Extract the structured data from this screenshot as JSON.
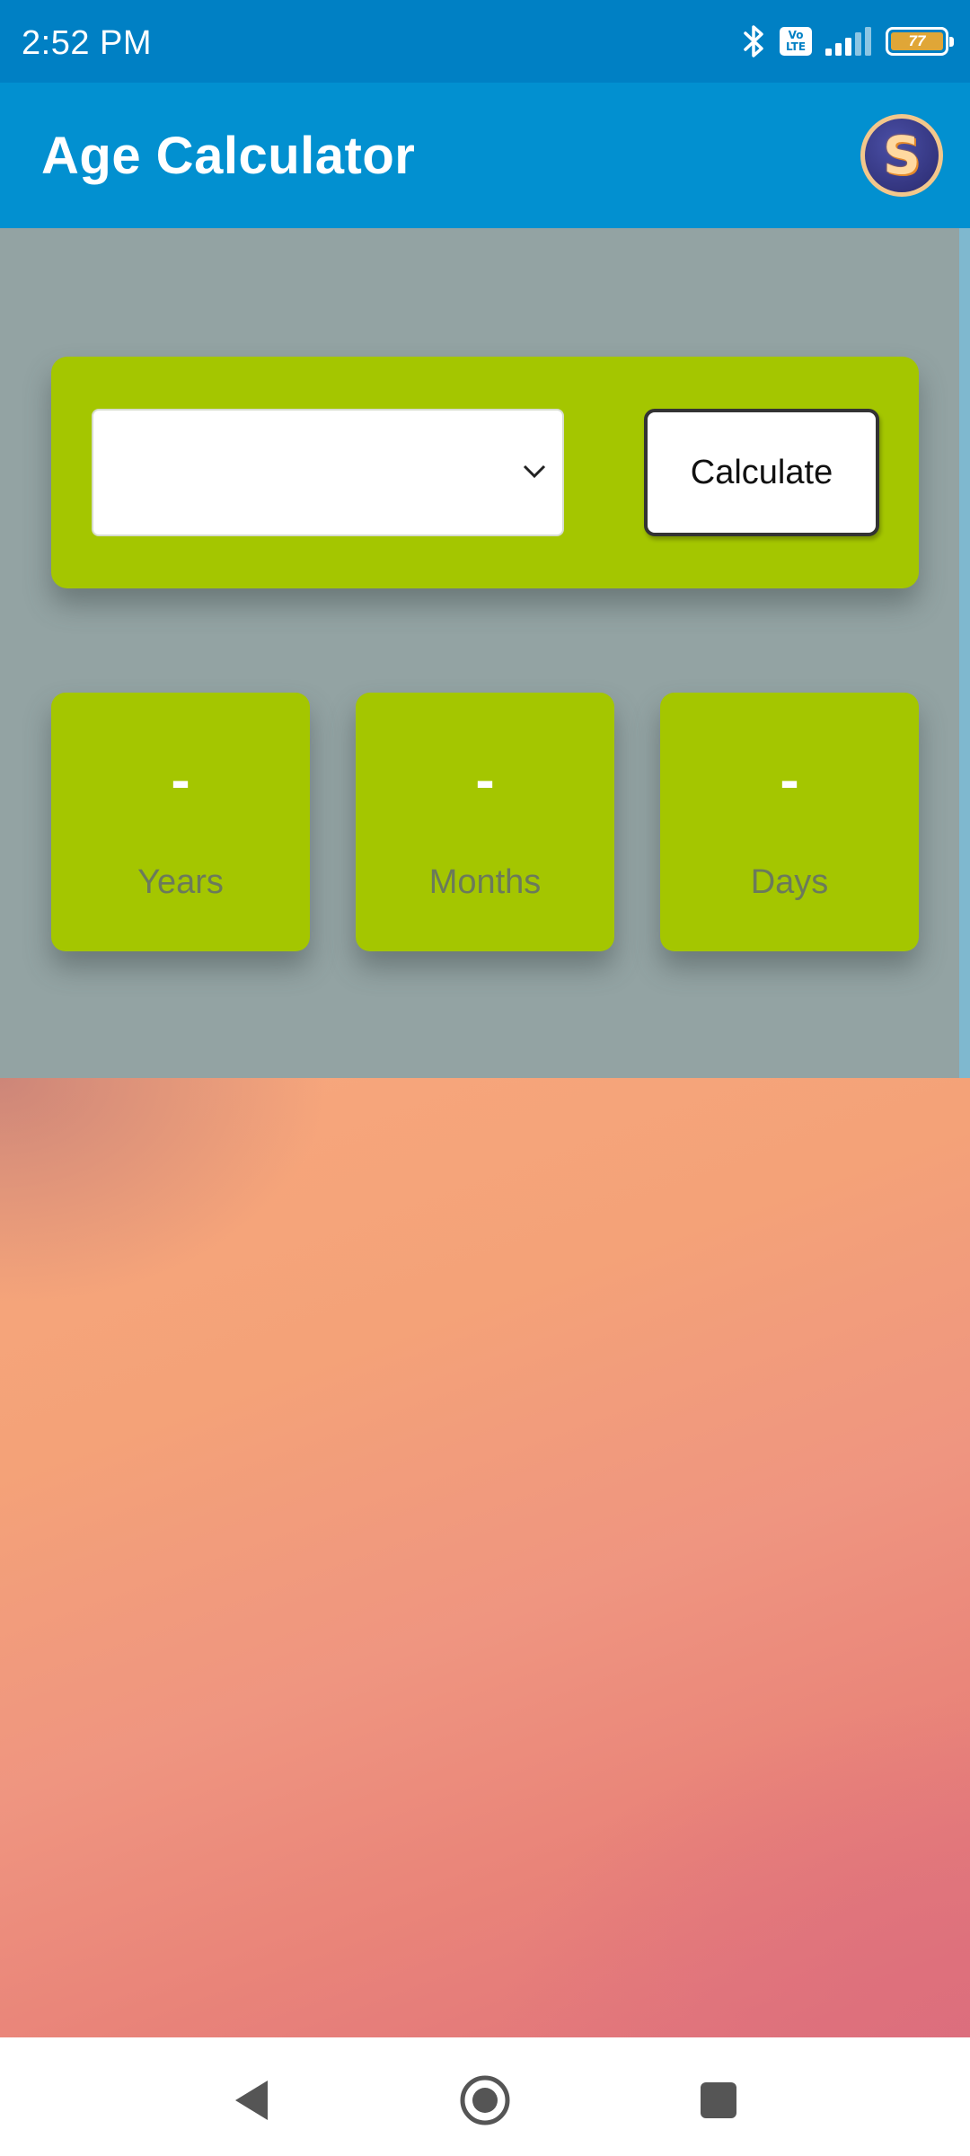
{
  "status_bar": {
    "time": "2:52 PM",
    "battery_level": "77",
    "icons": [
      "bluetooth-icon",
      "volte-icon",
      "signal-icon",
      "battery-icon"
    ],
    "volte_line1": "Vo",
    "volte_line2": "LTE"
  },
  "app_bar": {
    "title": "Age Calculator",
    "avatar_letter": "S"
  },
  "form": {
    "date_select_value": "",
    "calculate_label": "Calculate"
  },
  "results": {
    "years_value": "-",
    "years_label": "Years",
    "months_value": "-",
    "months_label": "Months",
    "days_value": "-",
    "days_label": "Days"
  },
  "colors": {
    "status_bar": "#0080c4",
    "app_bar": "#0290d0",
    "panel": "#93a3a3",
    "card_green": "#a4c600",
    "label_gray": "#6b7a5b"
  },
  "nav_bar": {
    "buttons": [
      "back-icon",
      "home-icon",
      "recents-icon"
    ]
  }
}
